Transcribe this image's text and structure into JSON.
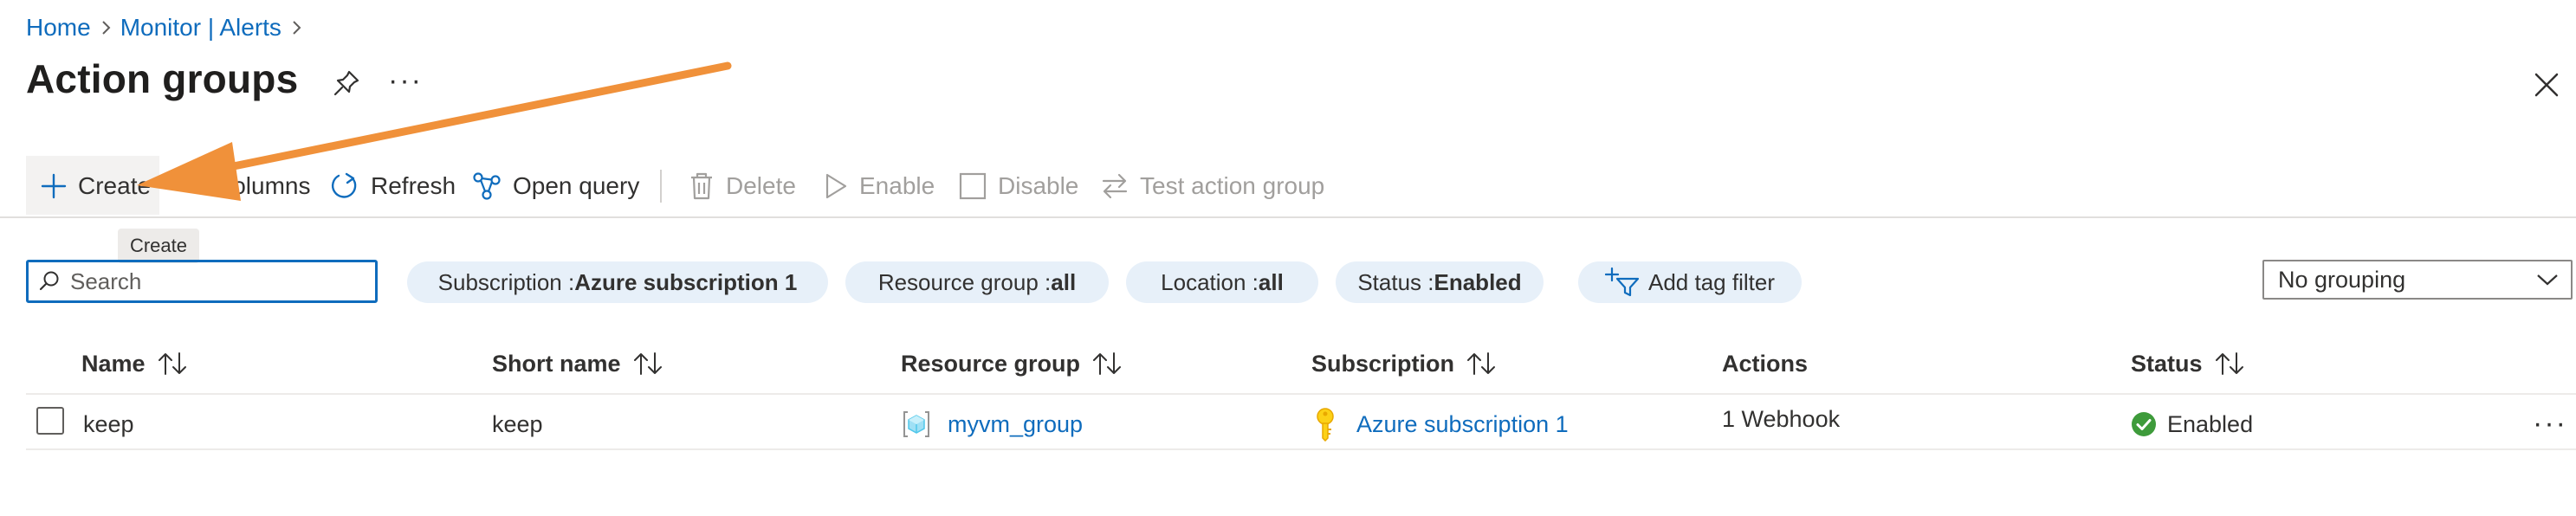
{
  "breadcrumb": {
    "home": "Home",
    "monitor_alerts": "Monitor | Alerts"
  },
  "page": {
    "title": "Action groups",
    "more": "···"
  },
  "toolbar": {
    "create": "Create",
    "columns": "Columns",
    "refresh": "Refresh",
    "open_query": "Open query",
    "delete": "Delete",
    "enable": "Enable",
    "disable": "Disable",
    "test_action_group": "Test action group"
  },
  "tooltip": {
    "text": "Create"
  },
  "search": {
    "placeholder": "Search",
    "value": ""
  },
  "filters": {
    "subscription": {
      "label": "Subscription : ",
      "value": "Azure subscription 1"
    },
    "resource_group": {
      "label": "Resource group : ",
      "value": "all"
    },
    "location": {
      "label": "Location : ",
      "value": "all"
    },
    "status": {
      "label": "Status : ",
      "value": "Enabled"
    },
    "add_tag": "Add tag filter"
  },
  "grouping": {
    "selected": "No grouping"
  },
  "table": {
    "columns": {
      "name": "Name",
      "short_name": "Short name",
      "resource_group": "Resource group",
      "subscription": "Subscription",
      "actions": "Actions",
      "status": "Status"
    },
    "rows": [
      {
        "name": "keep",
        "short_name": "keep",
        "resource_group": "myvm_group",
        "subscription": "Azure subscription 1",
        "actions": "1 Webhook",
        "status": "Enabled",
        "more": "···"
      }
    ]
  },
  "colors": {
    "accent": "#0f6cbd",
    "pill_bg": "#e7f0f9",
    "annotation_arrow": "#f0913a",
    "status_ok": "#3e9b3b"
  }
}
